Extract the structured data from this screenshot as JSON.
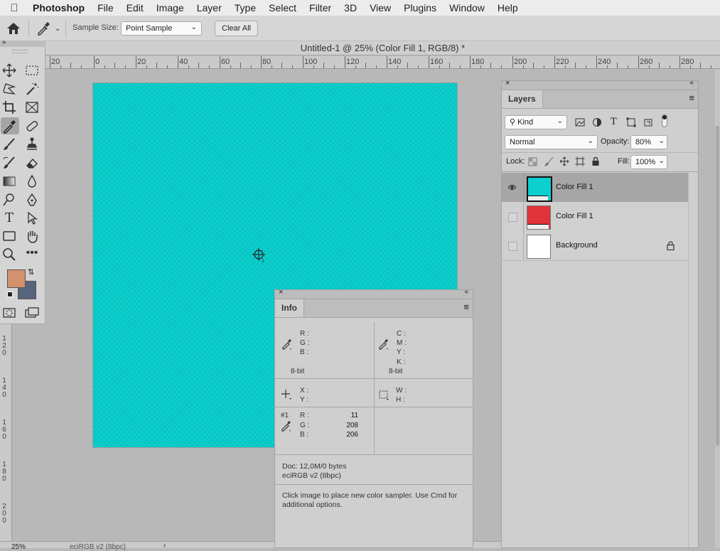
{
  "menubar": {
    "apple_icon": "apple-logo-icon",
    "items": [
      "Photoshop",
      "File",
      "Edit",
      "Image",
      "Layer",
      "Type",
      "Select",
      "Filter",
      "3D",
      "View",
      "Plugins",
      "Window",
      "Help"
    ]
  },
  "options": {
    "sample_size_label": "Sample Size:",
    "sample_size_value": "Point Sample",
    "clear_all_label": "Clear All"
  },
  "document": {
    "title": "Untitled-1 @ 25% (Color Fill 1, RGB/8) *",
    "fill_color": "#0bd0ce"
  },
  "ruler": {
    "h_labels": [
      "20",
      "0",
      "20",
      "40",
      "60",
      "80",
      "100",
      "120",
      "140",
      "160",
      "180",
      "200",
      "220",
      "240",
      "260",
      "280"
    ],
    "v_labels": [
      "1 2 0",
      "1 4 0",
      "1 6 0",
      "1 8 0",
      "2 0 0"
    ]
  },
  "status": {
    "zoom": "25%",
    "profile": "eciRGB v2 (8bpc)"
  },
  "colors": {
    "foreground": "#d4916e",
    "background": "#56657d",
    "accent_cyan": "#0bd0ce",
    "accent_red": "#e0333b"
  },
  "layers_panel": {
    "tab": "Layers",
    "kind_label": "Kind",
    "blend_mode": "Normal",
    "opacity_label": "Opacity:",
    "opacity_value": "80%",
    "lock_label": "Lock:",
    "fill_label": "Fill:",
    "fill_value": "100%",
    "layers": [
      {
        "name": "Color Fill 1",
        "thumb": "#0bd0ce",
        "selected": true,
        "visible": true
      },
      {
        "name": "Color Fill 1",
        "thumb": "#e0333b",
        "selected": false,
        "visible": false
      },
      {
        "name": "Background",
        "thumb": "#ffffff",
        "selected": false,
        "visible": false,
        "locked": true
      }
    ]
  },
  "info_panel": {
    "tab": "Info",
    "rgb_labels": {
      "r": "R :",
      "g": "G :",
      "b": "B :"
    },
    "cmyk_labels": {
      "c": "C :",
      "m": "M :",
      "y": "Y :",
      "k": "K :"
    },
    "bit_left": "8-bit",
    "bit_right": "8-bit",
    "xy_labels": {
      "x": "X :",
      "y": "Y :"
    },
    "wh_labels": {
      "w": "W :",
      "h": "H :"
    },
    "sampler": {
      "id": "#1",
      "r_label": "R :",
      "g_label": "G :",
      "b_label": "B :",
      "r": "11",
      "g": "208",
      "b": "206"
    },
    "doc": "Doc: 12,0M/0 bytes",
    "profile": "eciRGB v2 (8bpc)",
    "hint": "Click image to place new color sampler.  Use Cmd for additional options."
  }
}
